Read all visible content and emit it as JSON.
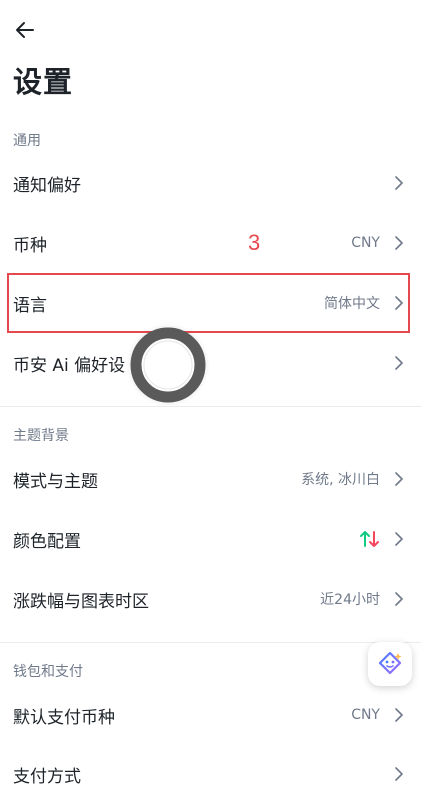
{
  "page": {
    "title": "设置"
  },
  "sections": {
    "general": {
      "title": "通用",
      "items": [
        {
          "label": "通知偏好",
          "value": ""
        },
        {
          "label": "币种",
          "value": "CNY"
        },
        {
          "label": "语言",
          "value": "简体中文"
        },
        {
          "label": "币安 Ai 偏好设",
          "value": ""
        }
      ]
    },
    "theme": {
      "title": "主题背景",
      "items": [
        {
          "label": "模式与主题",
          "value": "系统, 冰川白"
        },
        {
          "label": "颜色配置",
          "value": ""
        },
        {
          "label": "涨跌幅与图表时区",
          "value": "近24小时"
        }
      ]
    },
    "wallet": {
      "title": "钱包和支付",
      "items": [
        {
          "label": "默认支付币种",
          "value": "CNY"
        },
        {
          "label": "支付方式",
          "value": ""
        }
      ]
    }
  },
  "annotation": {
    "step_number": "3",
    "color": "#e5484d"
  },
  "colors": {
    "up": "#0ecb81",
    "down": "#f6465d",
    "text_primary": "#1e2329",
    "text_secondary": "#707a8a"
  },
  "icons": {
    "back": "arrow-left-icon",
    "chevron": "chevron-right-icon",
    "color_config": "up-down-arrows-icon",
    "ai_assistant": "ai-sparkle-icon"
  }
}
